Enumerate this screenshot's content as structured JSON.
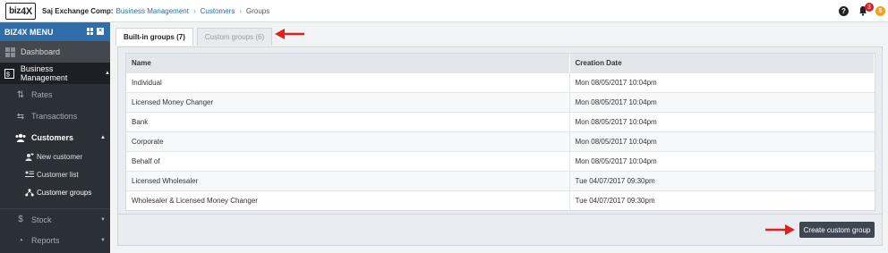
{
  "header": {
    "company": "Saj Exchange Comp:",
    "breadcrumbs": [
      "Business Management",
      "Customers",
      "Groups"
    ],
    "notification_count": "3",
    "help_glyph": "?",
    "coin_glyph": "$"
  },
  "logo": {
    "text": "biz",
    "accent": "4X"
  },
  "sidebar": {
    "title": "BIZ4X MENU",
    "items": [
      {
        "label": "Dashboard",
        "icon": "dashboard-icon"
      },
      {
        "label": "Business Management",
        "icon": "business-icon"
      },
      {
        "label": "Rates",
        "icon": "rates-icon"
      },
      {
        "label": "Transactions",
        "icon": "transactions-icon"
      },
      {
        "label": "Customers",
        "icon": "users-icon"
      },
      {
        "label": "New customer",
        "icon": "add-user-icon"
      },
      {
        "label": "Customer list",
        "icon": "list-icon"
      },
      {
        "label": "Customer groups",
        "icon": "groups-icon"
      },
      {
        "label": "Stock",
        "icon": "stock-icon"
      },
      {
        "label": "Reports",
        "icon": "reports-icon"
      }
    ]
  },
  "tabs": [
    {
      "label": "Built-in groups (7)",
      "active": true
    },
    {
      "label": "Custom groups (6)",
      "active": false
    }
  ],
  "table": {
    "columns": [
      "Name",
      "Creation Date"
    ],
    "rows": [
      [
        "Individual",
        "Mon 08/05/2017 10:04pm"
      ],
      [
        "Licensed Money Changer",
        "Mon 08/05/2017 10:04pm"
      ],
      [
        "Bank",
        "Mon 08/05/2017 10:04pm"
      ],
      [
        "Corporate",
        "Mon 08/05/2017 10:04pm"
      ],
      [
        "Behalf of",
        "Mon 08/05/2017 10:04pm"
      ],
      [
        "Licensed Wholesaler",
        "Tue 04/07/2017 09:30pm"
      ],
      [
        "Wholesaler & Licensed Money Changer",
        "Tue 04/07/2017 09:30pm"
      ]
    ]
  },
  "actions": {
    "create_label": "Create custom group"
  },
  "colors": {
    "accent": "#2f6ea8",
    "sidebar": "#2b2f36",
    "arrow": "#e0201c",
    "badge": "#d0202a",
    "coin": "#f0a020"
  }
}
